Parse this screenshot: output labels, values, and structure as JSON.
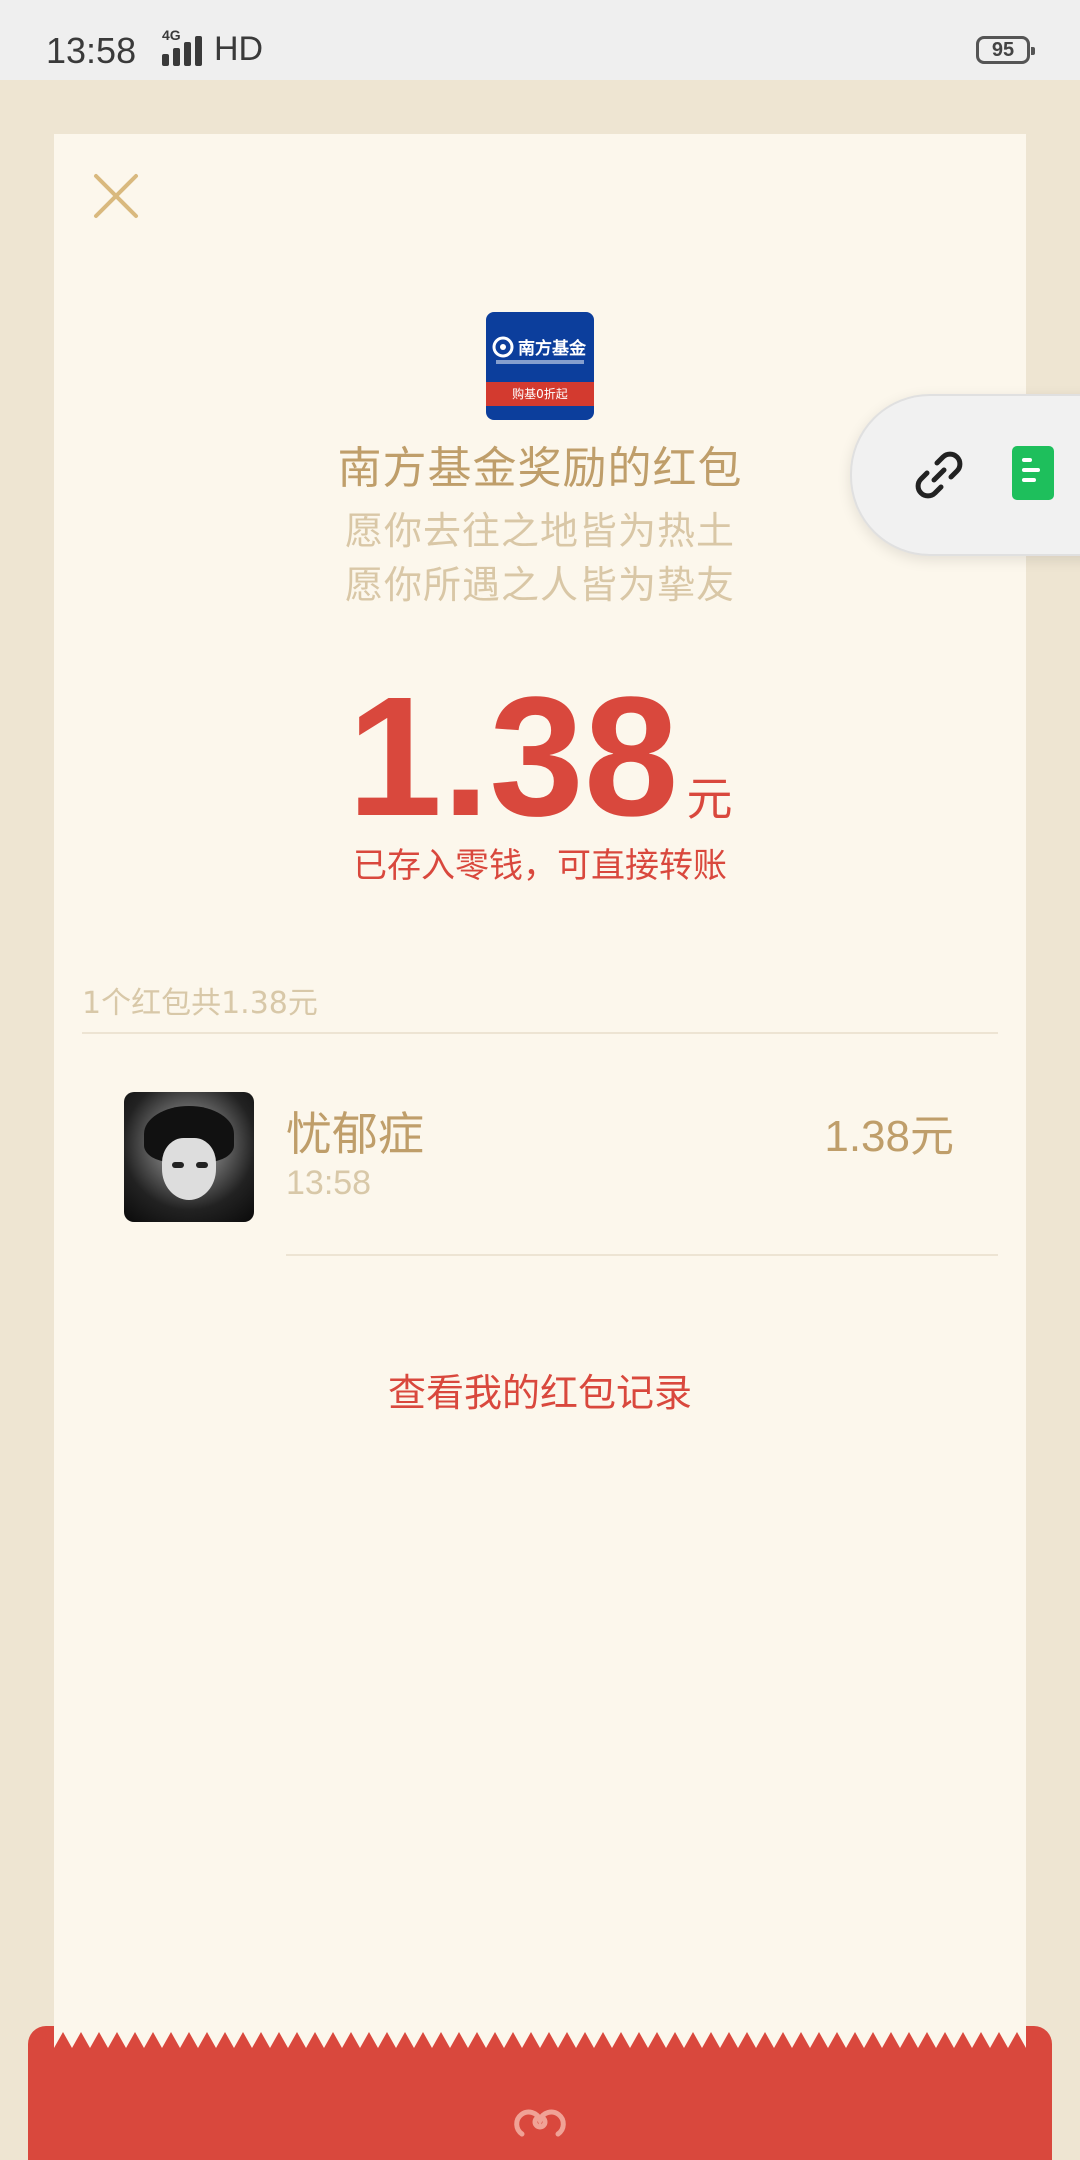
{
  "status_bar": {
    "time": "13:58",
    "network_small": "4G",
    "hd": "HD",
    "battery": "95"
  },
  "envelope": {
    "sender_title": "南方基金奖励的红包",
    "logo": {
      "name": "南方基金",
      "ribbon": "购基0折起"
    },
    "blessing_line1": "愿你去往之地皆为热土",
    "blessing_line2": "愿你所遇之人皆为挚友",
    "amount": "1.38",
    "currency": "元",
    "saved_note": "已存入零钱，可直接转账",
    "summary": "1个红包共1.38元"
  },
  "records": [
    {
      "name": "忧郁症",
      "time": "13:58",
      "amount": "1.38元"
    }
  ],
  "history_link": "查看我的红包记录",
  "icons": {
    "close": "close-icon",
    "link": "link-icon",
    "doc": "document-icon",
    "emblem": "cloud-emblem-icon"
  },
  "colors": {
    "accent_red": "#D9483D",
    "gold_text": "#BF9E6A",
    "light_gold": "#D9C7A6",
    "card_bg": "#FCF7EC",
    "page_bg": "#EEE5D2"
  }
}
